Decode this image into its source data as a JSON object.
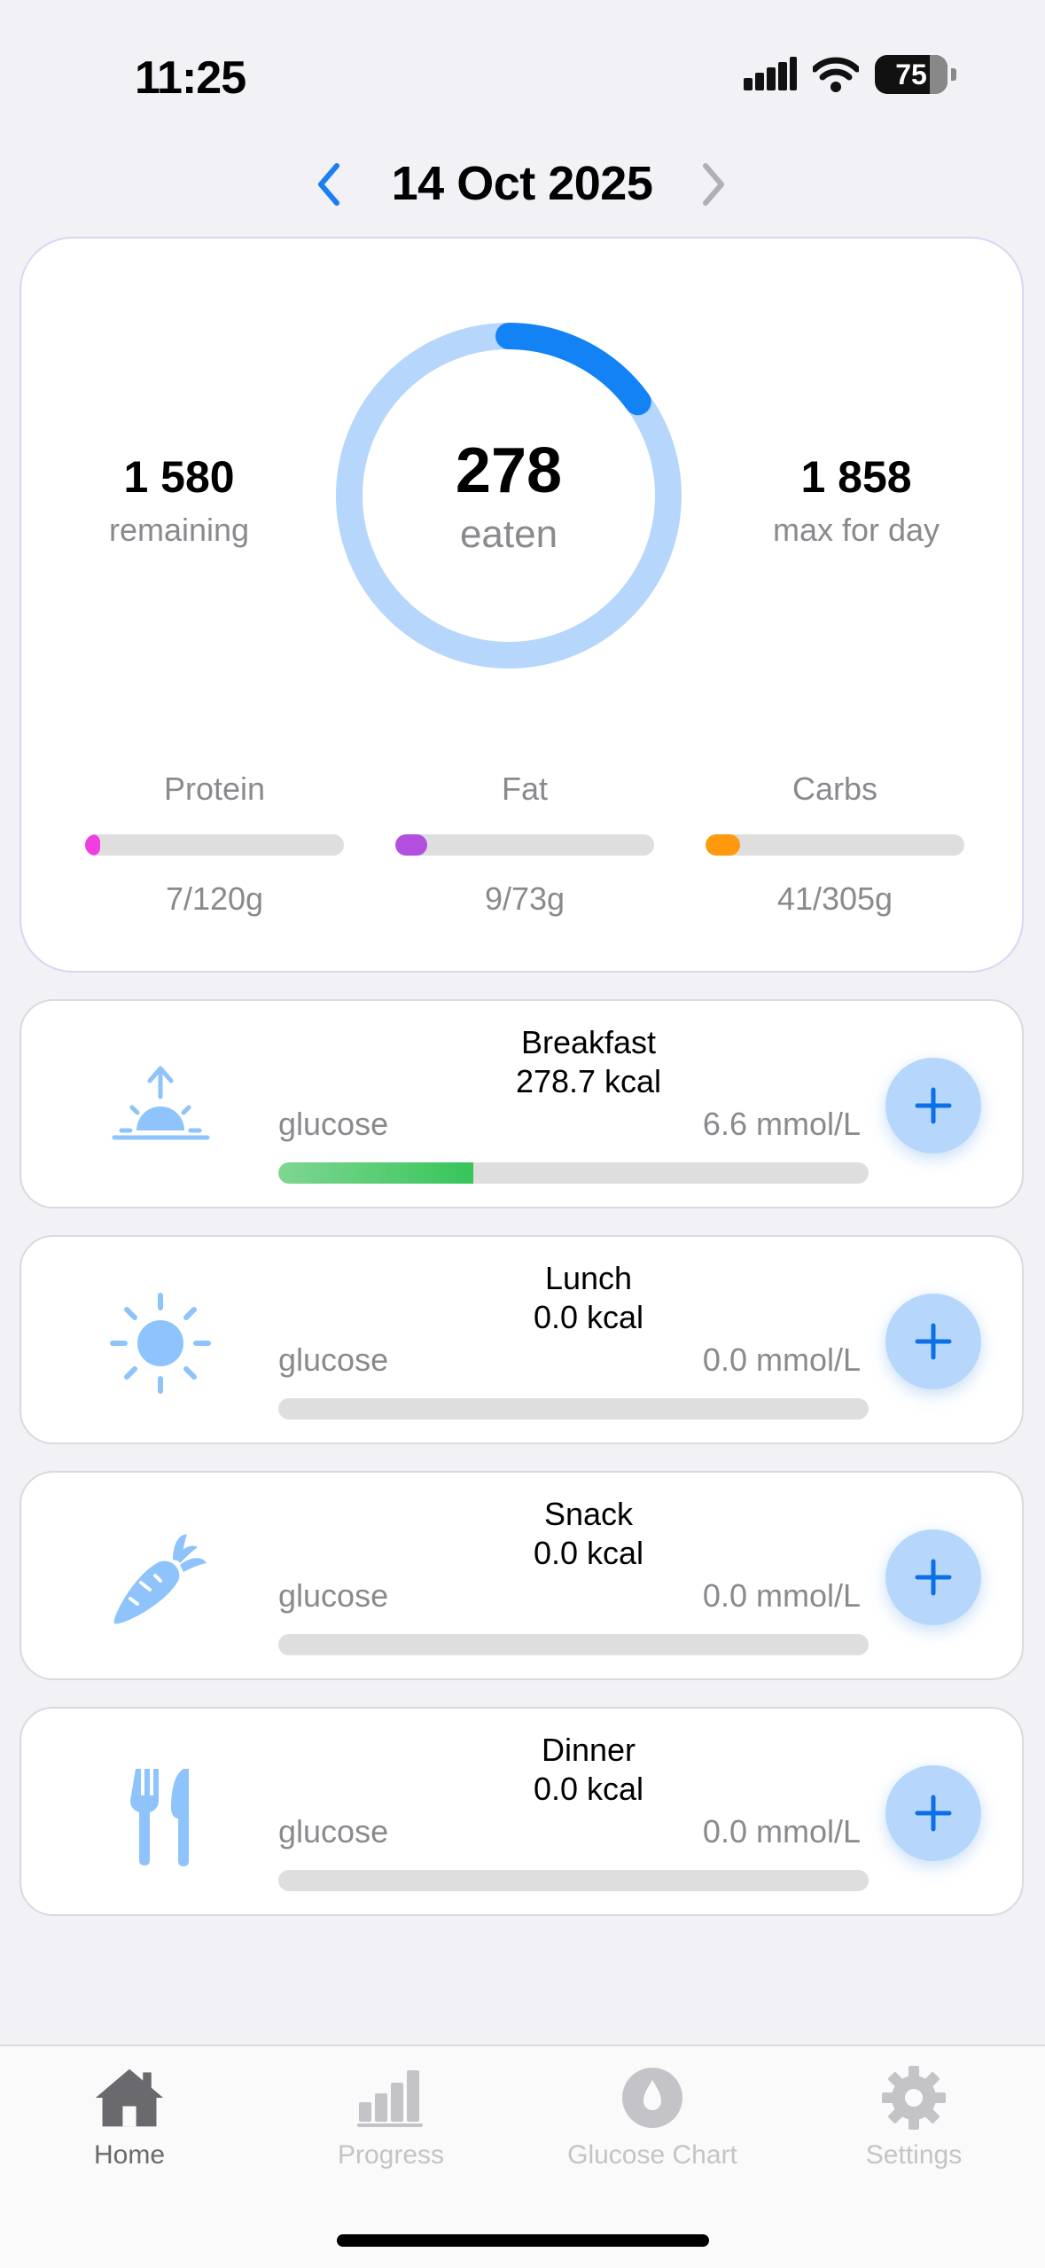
{
  "status_bar": {
    "time": "11:25",
    "battery": "75"
  },
  "header": {
    "date": "14 Oct 2025"
  },
  "summary": {
    "remaining_value": "1 580",
    "remaining_label": "remaining",
    "eaten_value": "278",
    "eaten_label": "eaten",
    "eaten_fraction": 0.15,
    "max_value": "1 858",
    "max_label": "max for day",
    "colors": {
      "ring_track": "#b6d6fb",
      "ring_progress": "#1282f5"
    }
  },
  "macros": [
    {
      "name": "Protein",
      "amount": "7/120g",
      "fraction": 0.058,
      "color": "#f03ee0"
    },
    {
      "name": "Fat",
      "amount": "9/73g",
      "fraction": 0.123,
      "color": "#b24fdf"
    },
    {
      "name": "Carbs",
      "amount": "41/305g",
      "fraction": 0.134,
      "color": "#ff9a0e"
    }
  ],
  "meals": [
    {
      "name": "Breakfast",
      "kcal": "278.7 kcal",
      "glucose_label": "glucose",
      "glucose_value": "6.6 mmol/L",
      "glucose_fraction": 0.33,
      "icon": "sunrise-icon"
    },
    {
      "name": "Lunch",
      "kcal": "0.0 kcal",
      "glucose_label": "glucose",
      "glucose_value": "0.0 mmol/L",
      "glucose_fraction": 0,
      "icon": "sun-icon"
    },
    {
      "name": "Snack",
      "kcal": "0.0 kcal",
      "glucose_label": "glucose",
      "glucose_value": "0.0 mmol/L",
      "glucose_fraction": 0,
      "icon": "carrot-icon"
    },
    {
      "name": "Dinner",
      "kcal": "0.0 kcal",
      "glucose_label": "glucose",
      "glucose_value": "0.0 mmol/L",
      "glucose_fraction": 0,
      "icon": "fork-knife-icon"
    }
  ],
  "tabs": [
    {
      "label": "Home",
      "icon": "house-icon",
      "active": true
    },
    {
      "label": "Progress",
      "icon": "bar-chart-icon",
      "active": false
    },
    {
      "label": "Glucose Chart",
      "icon": "drop-icon",
      "active": false
    },
    {
      "label": "Settings",
      "icon": "gear-icon",
      "active": false
    }
  ]
}
